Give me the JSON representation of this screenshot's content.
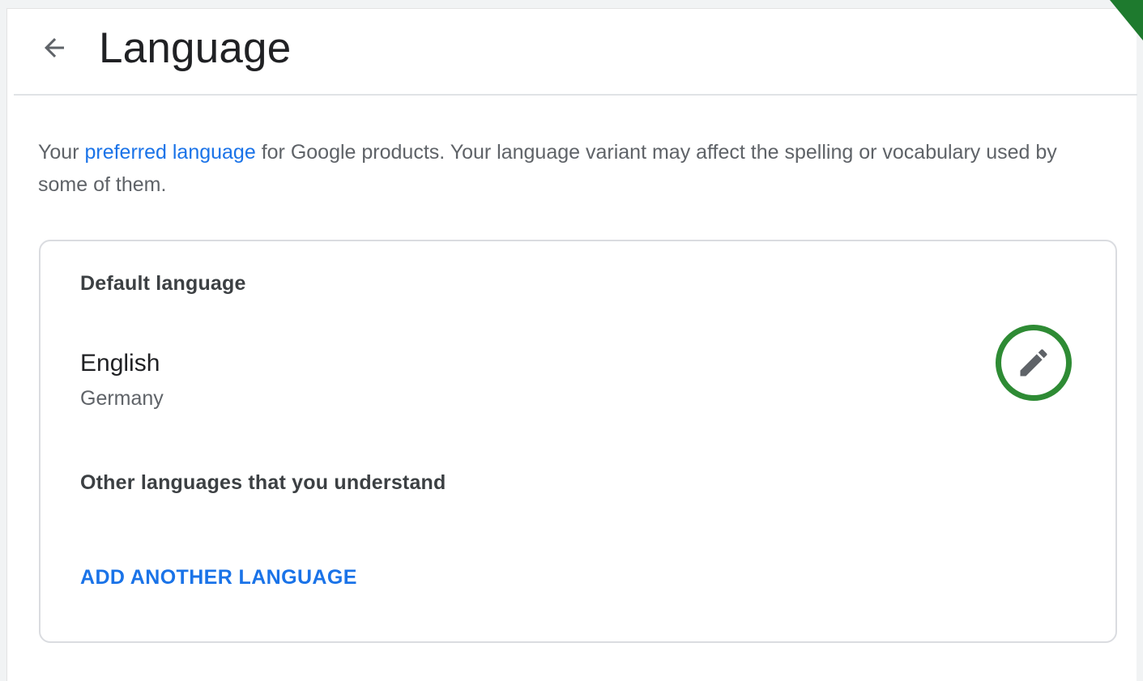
{
  "header": {
    "title": "Language",
    "back_icon": "arrow-back-icon"
  },
  "intro": {
    "before_link": "Your ",
    "link_text": "preferred language",
    "after_link": " for Google products. Your language variant may affect the spelling or vocabulary used by some of them."
  },
  "default_language": {
    "label": "Default language",
    "name": "English",
    "region": "Germany",
    "edit_icon": "pencil-icon"
  },
  "other_languages": {
    "label": "Other languages that you understand",
    "add_label": "ADD ANOTHER LANGUAGE"
  },
  "colors": {
    "accent": "#1a73e8",
    "highlight_ring": "#2e8b34",
    "corner_accent": "#1e7a2e"
  }
}
